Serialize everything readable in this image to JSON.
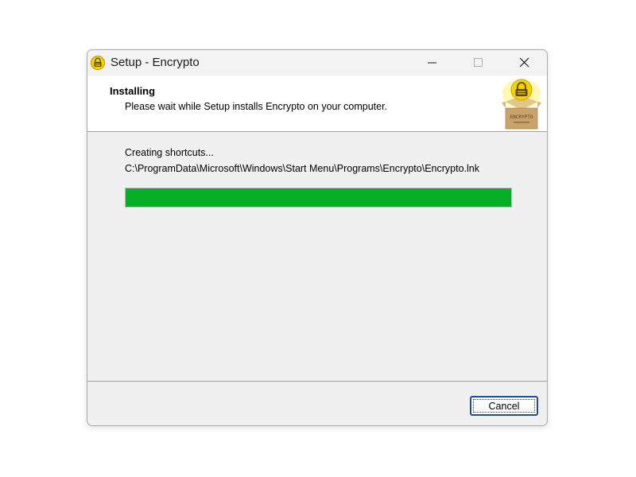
{
  "window": {
    "title": "Setup - Encrypto",
    "controls": {
      "minimize_icon": "minimize-icon",
      "maximize_icon": "maximize-icon",
      "close_icon": "close-icon"
    }
  },
  "header": {
    "title": "Installing",
    "subtitle": "Please wait while Setup installs Encrypto on your computer.",
    "graphic_label": "ENCRYPTO"
  },
  "progress": {
    "status": "Creating shortcuts...",
    "current_file": "C:\\ProgramData\\Microsoft\\Windows\\Start Menu\\Programs\\Encrypto\\Encrypto.lnk",
    "percent": 100
  },
  "footer": {
    "cancel_label": "Cancel"
  },
  "colors": {
    "progress_fill": "#06b025",
    "icon_yellow": "#f5d000",
    "box_brown": "#c9a36b"
  }
}
